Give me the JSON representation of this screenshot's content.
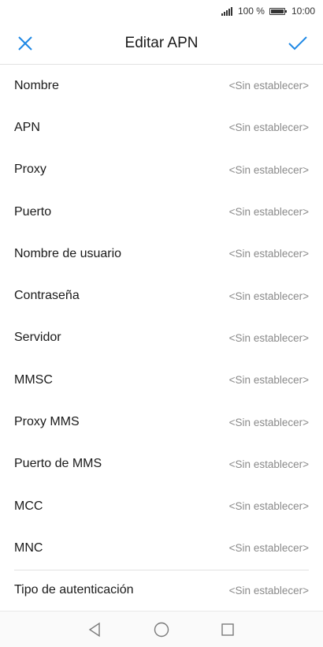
{
  "status_bar": {
    "signal_icon": "signal-icon",
    "battery_percent": "100 %",
    "battery_icon": "battery-icon",
    "time": "10:00"
  },
  "app_bar": {
    "title": "Editar APN",
    "close_icon": "close-icon",
    "confirm_icon": "check-icon",
    "accent_color": "#1e88e5"
  },
  "fields": [
    {
      "label": "Nombre",
      "value": "<Sin establecer>"
    },
    {
      "label": "APN",
      "value": "<Sin establecer>"
    },
    {
      "label": "Proxy",
      "value": "<Sin establecer>"
    },
    {
      "label": "Puerto",
      "value": "<Sin establecer>"
    },
    {
      "label": "Nombre de usuario",
      "value": "<Sin establecer>"
    },
    {
      "label": "Contraseña",
      "value": "<Sin establecer>"
    },
    {
      "label": "Servidor",
      "value": "<Sin establecer>"
    },
    {
      "label": "MMSC",
      "value": "<Sin establecer>"
    },
    {
      "label": "Proxy MMS",
      "value": "<Sin establecer>"
    },
    {
      "label": "Puerto de MMS",
      "value": "<Sin establecer>"
    },
    {
      "label": "MCC",
      "value": "<Sin establecer>"
    },
    {
      "label": "MNC",
      "value": "<Sin establecer>"
    },
    {
      "label": "Tipo de autenticación",
      "value": "<Sin establecer>"
    }
  ],
  "nav_bar": {
    "back_icon": "back-triangle-icon",
    "home_icon": "home-circle-icon",
    "recents_icon": "recents-square-icon"
  }
}
